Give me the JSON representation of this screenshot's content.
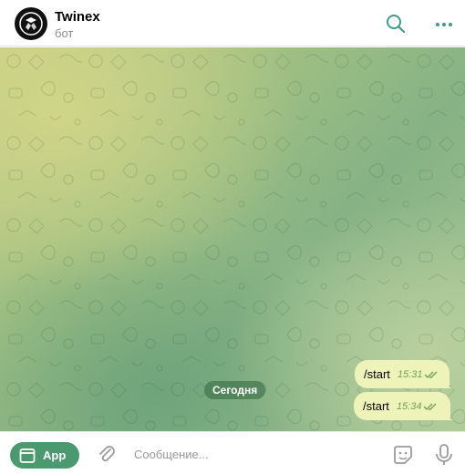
{
  "header": {
    "title": "Twinex",
    "subtitle": "бот",
    "icons": {
      "avatar": "twinex-logo",
      "search": "search-icon",
      "more": "more-dots-icon"
    }
  },
  "chat": {
    "date_label": "Сегодня",
    "messages": [
      {
        "text": "/start",
        "time": "15:31",
        "status": "read"
      },
      {
        "text": "/start",
        "time": "15:34",
        "status": "read"
      }
    ]
  },
  "composer": {
    "app_label": "App",
    "placeholder": "Сообщение...",
    "icons": {
      "app": "app-window-icon",
      "attach": "paperclip-icon",
      "sticker": "sticker-icon",
      "mic": "microphone-icon"
    }
  },
  "colors": {
    "accent": "#4b9a6f",
    "icon": "#3f9a87",
    "bubble": "#eef3b9",
    "check": "#6fa25a",
    "date_pill": "#467850"
  }
}
